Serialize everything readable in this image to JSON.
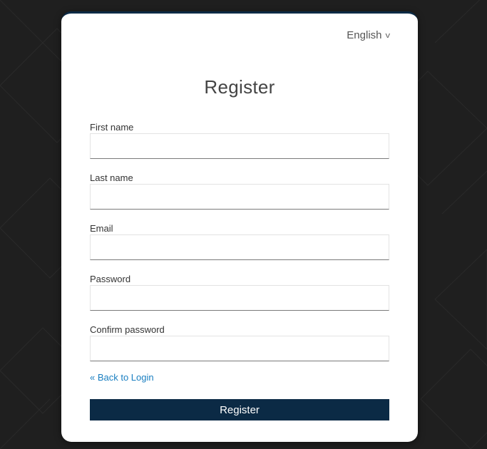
{
  "language": {
    "selected": "English",
    "chevron_icon": "chevron-down-icon"
  },
  "form": {
    "title": "Register",
    "fields": [
      {
        "label": "First name",
        "value": "",
        "placeholder": ""
      },
      {
        "label": "Last name",
        "value": "",
        "placeholder": ""
      },
      {
        "label": "Email",
        "value": "",
        "placeholder": ""
      },
      {
        "label": "Password",
        "value": "",
        "placeholder": ""
      },
      {
        "label": "Confirm password",
        "value": "",
        "placeholder": ""
      }
    ],
    "back_link": "« Back to Login",
    "submit_label": "Register"
  },
  "colors": {
    "page_background": "#1f1f1f",
    "card_background": "#ffffff",
    "button_background": "#0b2a45",
    "link": "#1a7fc1"
  }
}
